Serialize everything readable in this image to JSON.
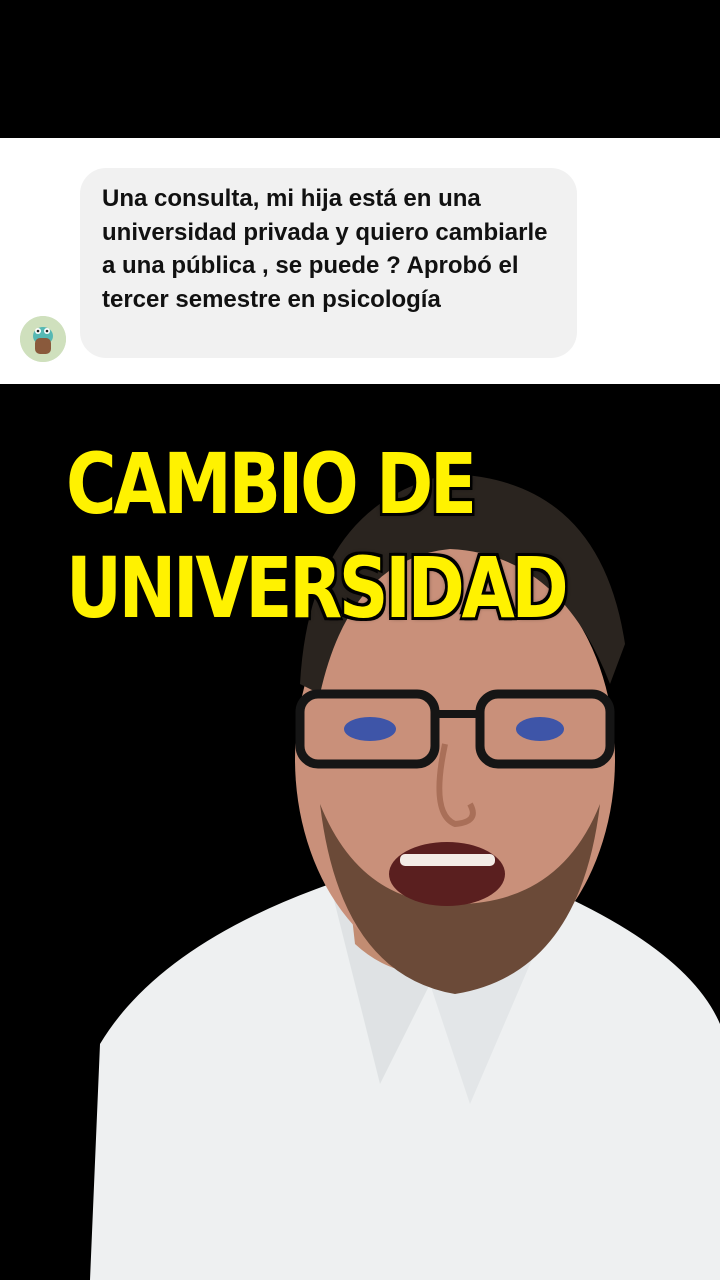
{
  "comment": {
    "text": "Una consulta, mi hija está en una universidad privada y quiero cambiarle a una pública , se puede ? Aprobó el tercer semestre en psicología",
    "avatar_icon": "avatar-icon"
  },
  "caption": {
    "line1": "CAMBIO DE",
    "line2": "UNIVERSIDAD",
    "color": "#fff200"
  },
  "video": {
    "subject": "presenter"
  }
}
